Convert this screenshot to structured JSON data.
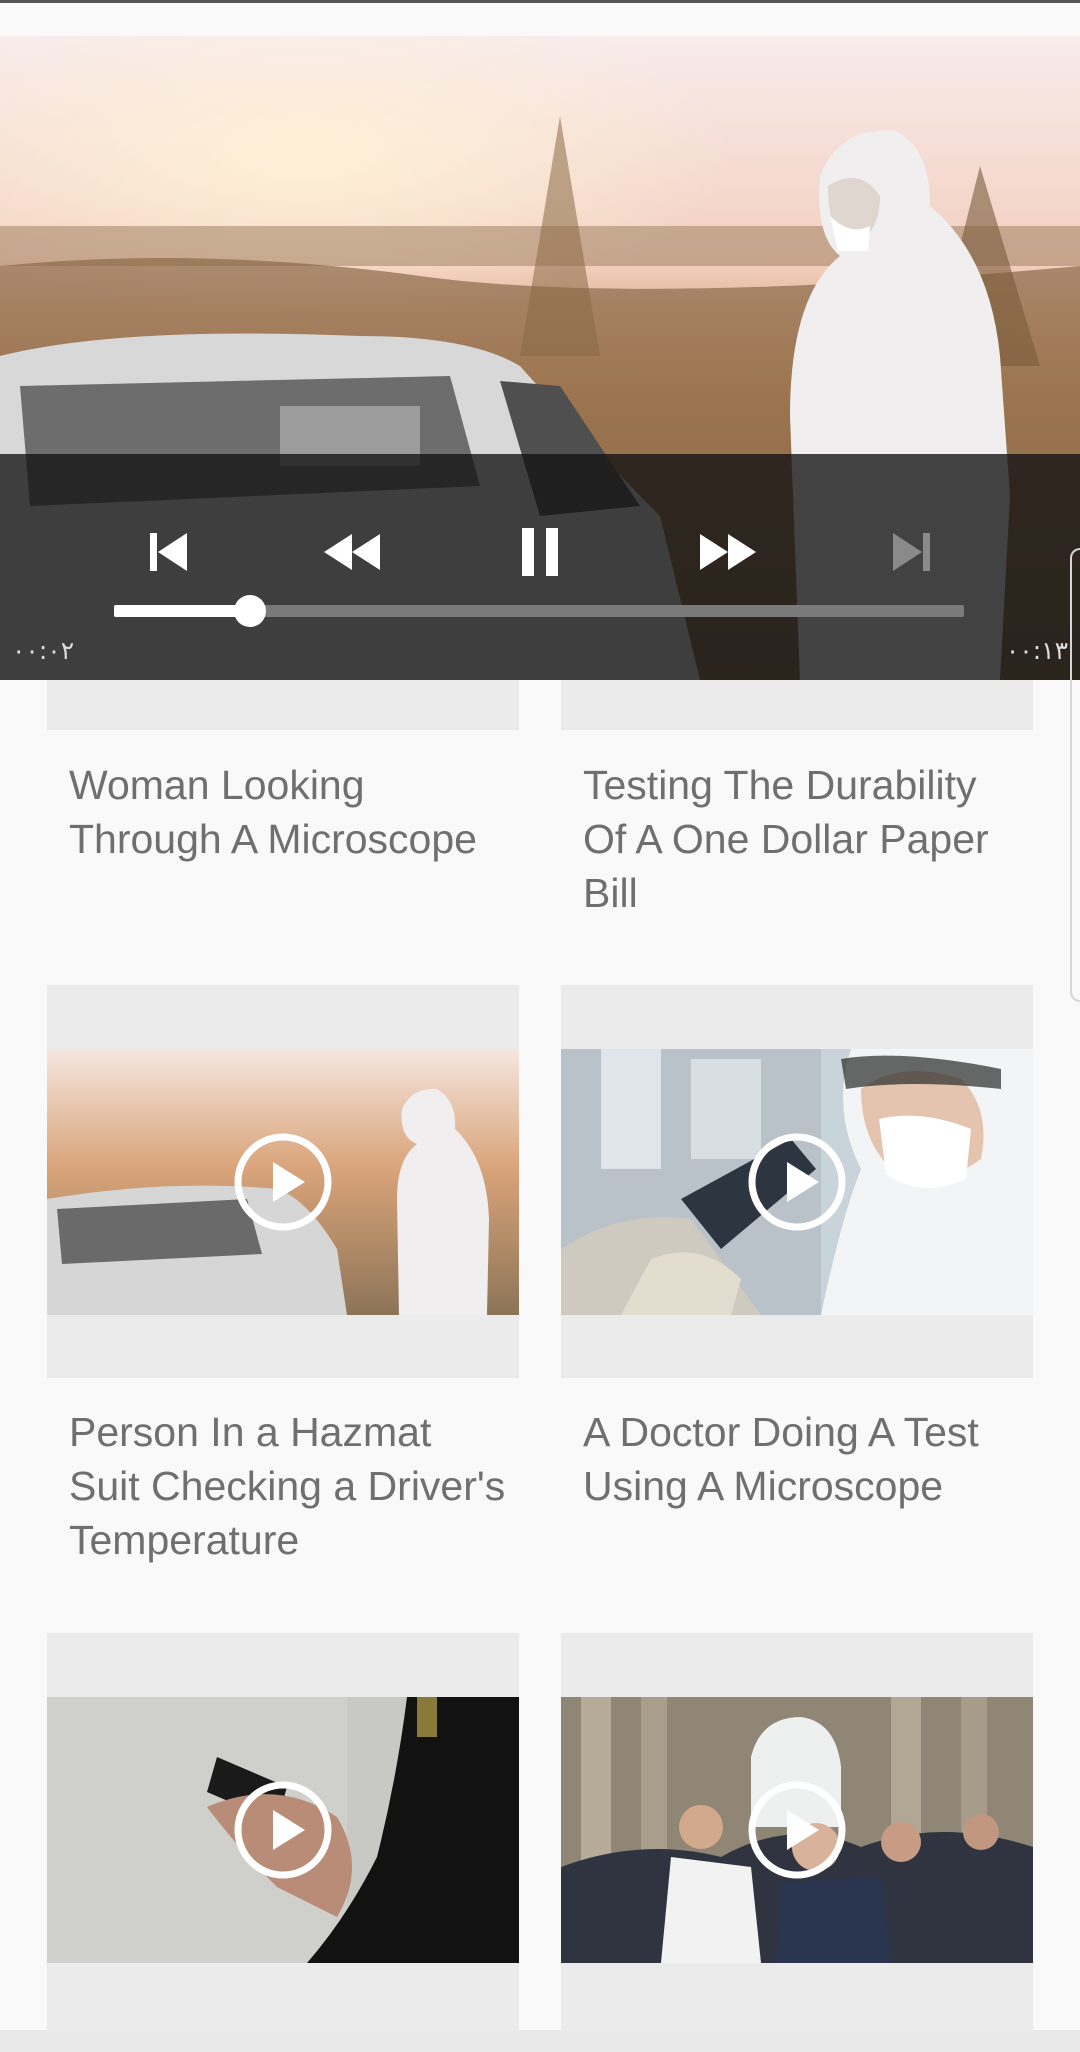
{
  "player": {
    "time_elapsed": "۰۰:۰۲",
    "time_total": "۰۰:۱۳",
    "progress_fraction": 0.16,
    "controls": {
      "previous": "skip-previous-icon",
      "rewind": "rewind-icon",
      "pause": "pause-icon",
      "fast_forward": "fast-forward-icon",
      "next": "skip-next-icon"
    }
  },
  "videos": [
    {
      "title": "Woman Looking Through A Microscope"
    },
    {
      "title": "Testing The Durability Of A One Dollar Paper Bill"
    },
    {
      "title": "Person In a Hazmat Suit Checking a Driver's Temperature"
    },
    {
      "title": "A Doctor Doing A Test Using A Microscope"
    },
    {
      "title": ""
    },
    {
      "title": ""
    }
  ],
  "colors": {
    "background": "#f9f9f9",
    "card_pad": "#ebebeb",
    "title_text": "#6f6f6f",
    "controls_bg": "#121212"
  }
}
